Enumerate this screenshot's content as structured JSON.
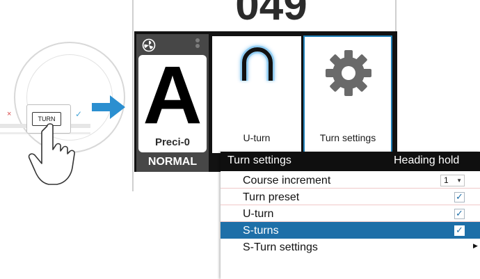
{
  "illustration": {
    "button_label": "TURN",
    "cancel_symbol": "×",
    "confirm_symbol": "✓"
  },
  "display": {
    "top_value": "049",
    "mode": {
      "letter": "A",
      "name": "Preci-0",
      "state": "NORMAL"
    },
    "tiles": [
      {
        "label": "U-turn",
        "icon": "u-turn-icon"
      },
      {
        "label": "Turn settings",
        "icon": "gear-icon"
      }
    ]
  },
  "menu": {
    "title": "Turn settings",
    "mode_label": "Heading hold",
    "items": [
      {
        "label": "Course increment",
        "control": "dropdown",
        "value": "1"
      },
      {
        "label": "Turn preset",
        "control": "checkbox",
        "checked": true
      },
      {
        "label": "U-turn",
        "control": "checkbox",
        "checked": true
      },
      {
        "label": "S-turns",
        "control": "checkbox",
        "checked": true,
        "selected": true
      },
      {
        "label": "S-Turn settings",
        "control": "submenu"
      }
    ]
  },
  "colors": {
    "accent": "#1e6fa8",
    "arrow": "#2b8fd0",
    "frame": "#121212",
    "mode_card": "#474747"
  }
}
